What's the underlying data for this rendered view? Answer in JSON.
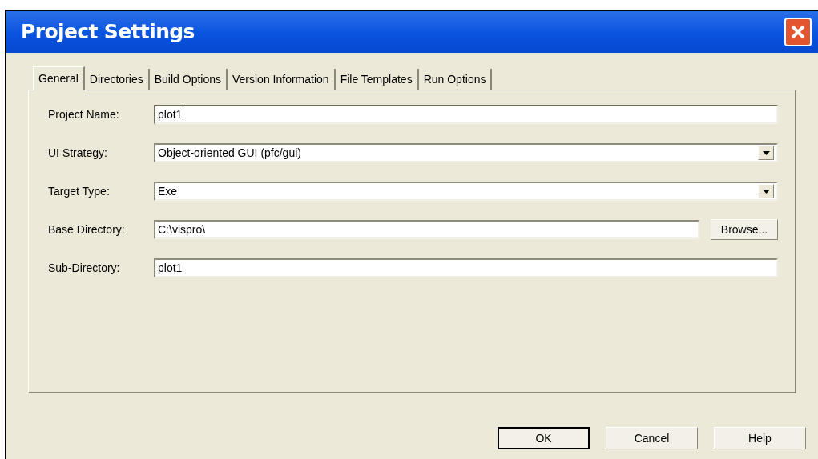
{
  "window": {
    "title": "Project Settings"
  },
  "tabs": [
    {
      "label": "General",
      "selected": true
    },
    {
      "label": "Directories",
      "selected": false
    },
    {
      "label": "Build Options",
      "selected": false
    },
    {
      "label": "Version Information",
      "selected": false
    },
    {
      "label": "File Templates",
      "selected": false
    },
    {
      "label": "Run Options",
      "selected": false
    }
  ],
  "fields": [
    {
      "kind": "text",
      "label": "Project Name:",
      "value": "plot1",
      "focused": true
    },
    {
      "kind": "dropdown",
      "label": "UI Strategy:",
      "value": "Object-oriented GUI (pfc/gui)",
      "focused": false
    },
    {
      "kind": "dropdown",
      "label": "Target Type:",
      "value": "Exe",
      "focused": false
    },
    {
      "kind": "browse",
      "label": "Base Directory:",
      "value": "C:\\vispro\\",
      "focused": false,
      "button": {
        "label": "Browse..."
      }
    },
    {
      "kind": "text",
      "label": "Sub-Directory:",
      "value": "plot1",
      "focused": false
    }
  ],
  "buttons": [
    {
      "label": "OK",
      "default": true
    },
    {
      "label": "Cancel",
      "default": false
    },
    {
      "label": "Help",
      "default": false
    }
  ]
}
